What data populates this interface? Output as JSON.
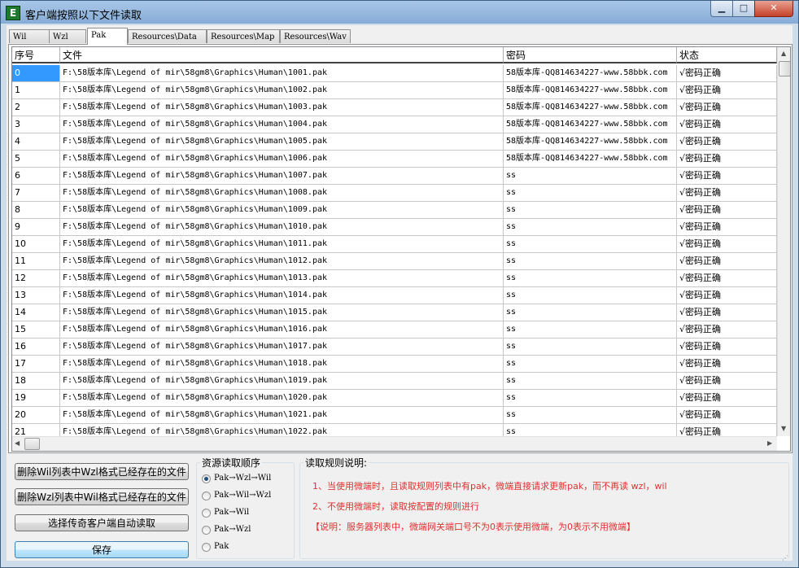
{
  "window": {
    "title": "客户端按照以下文件读取",
    "icon": "E"
  },
  "tabs": [
    {
      "label": "Wil",
      "active": false
    },
    {
      "label": "Wzl",
      "active": false
    },
    {
      "label": "Pak",
      "active": true
    },
    {
      "label": "Resources\\Data",
      "active": false
    },
    {
      "label": "Resources\\Map",
      "active": false
    },
    {
      "label": "Resources\\Wav",
      "active": false
    }
  ],
  "grid": {
    "headers": [
      "序号",
      "文件",
      "密码",
      "状态"
    ],
    "rows": [
      [
        "0",
        "F:\\58版本库\\Legend of mir\\58gm8\\Graphics\\Human\\1001.pak",
        "58版本库-QQ814634227-www.58bbk.com",
        "√密码正确"
      ],
      [
        "1",
        "F:\\58版本库\\Legend of mir\\58gm8\\Graphics\\Human\\1002.pak",
        "58版本库-QQ814634227-www.58bbk.com",
        "√密码正确"
      ],
      [
        "2",
        "F:\\58版本库\\Legend of mir\\58gm8\\Graphics\\Human\\1003.pak",
        "58版本库-QQ814634227-www.58bbk.com",
        "√密码正确"
      ],
      [
        "3",
        "F:\\58版本库\\Legend of mir\\58gm8\\Graphics\\Human\\1004.pak",
        "58版本库-QQ814634227-www.58bbk.com",
        "√密码正确"
      ],
      [
        "4",
        "F:\\58版本库\\Legend of mir\\58gm8\\Graphics\\Human\\1005.pak",
        "58版本库-QQ814634227-www.58bbk.com",
        "√密码正确"
      ],
      [
        "5",
        "F:\\58版本库\\Legend of mir\\58gm8\\Graphics\\Human\\1006.pak",
        "58版本库-QQ814634227-www.58bbk.com",
        "√密码正确"
      ],
      [
        "6",
        "F:\\58版本库\\Legend of mir\\58gm8\\Graphics\\Human\\1007.pak",
        "ss",
        "√密码正确"
      ],
      [
        "7",
        "F:\\58版本库\\Legend of mir\\58gm8\\Graphics\\Human\\1008.pak",
        "ss",
        "√密码正确"
      ],
      [
        "8",
        "F:\\58版本库\\Legend of mir\\58gm8\\Graphics\\Human\\1009.pak",
        "ss",
        "√密码正确"
      ],
      [
        "9",
        "F:\\58版本库\\Legend of mir\\58gm8\\Graphics\\Human\\1010.pak",
        "ss",
        "√密码正确"
      ],
      [
        "10",
        "F:\\58版本库\\Legend of mir\\58gm8\\Graphics\\Human\\1011.pak",
        "ss",
        "√密码正确"
      ],
      [
        "11",
        "F:\\58版本库\\Legend of mir\\58gm8\\Graphics\\Human\\1012.pak",
        "ss",
        "√密码正确"
      ],
      [
        "12",
        "F:\\58版本库\\Legend of mir\\58gm8\\Graphics\\Human\\1013.pak",
        "ss",
        "√密码正确"
      ],
      [
        "13",
        "F:\\58版本库\\Legend of mir\\58gm8\\Graphics\\Human\\1014.pak",
        "ss",
        "√密码正确"
      ],
      [
        "14",
        "F:\\58版本库\\Legend of mir\\58gm8\\Graphics\\Human\\1015.pak",
        "ss",
        "√密码正确"
      ],
      [
        "15",
        "F:\\58版本库\\Legend of mir\\58gm8\\Graphics\\Human\\1016.pak",
        "ss",
        "√密码正确"
      ],
      [
        "16",
        "F:\\58版本库\\Legend of mir\\58gm8\\Graphics\\Human\\1017.pak",
        "ss",
        "√密码正确"
      ],
      [
        "17",
        "F:\\58版本库\\Legend of mir\\58gm8\\Graphics\\Human\\1018.pak",
        "ss",
        "√密码正确"
      ],
      [
        "18",
        "F:\\58版本库\\Legend of mir\\58gm8\\Graphics\\Human\\1019.pak",
        "ss",
        "√密码正确"
      ],
      [
        "19",
        "F:\\58版本库\\Legend of mir\\58gm8\\Graphics\\Human\\1020.pak",
        "ss",
        "√密码正确"
      ],
      [
        "20",
        "F:\\58版本库\\Legend of mir\\58gm8\\Graphics\\Human\\1021.pak",
        "ss",
        "√密码正确"
      ],
      [
        "21",
        "F:\\58版本库\\Legend of mir\\58gm8\\Graphics\\Human\\1022.pak",
        "ss",
        "√密码正确"
      ]
    ]
  },
  "buttons": {
    "delete_wil": "删除Wil列表中Wzl格式已经存在的文件",
    "delete_wzl": "删除Wzl列表中Wil格式已经存在的文件",
    "select_client": "选择传奇客户端自动读取",
    "save": "保存"
  },
  "resource_order": {
    "title": "资源读取顺序",
    "options": [
      {
        "label": "Pak→Wzl→Wil",
        "checked": true
      },
      {
        "label": "Pak→Wil→Wzl",
        "checked": false
      },
      {
        "label": "Pak→Wil",
        "checked": false
      },
      {
        "label": "Pak→Wzl",
        "checked": false
      },
      {
        "label": "Pak",
        "checked": false
      }
    ]
  },
  "rules": {
    "title": "读取规则说明:",
    "lines": [
      "1、当使用微端时，且读取规则列表中有pak，微端直接请求更新pak，而不再读 wzl，wil",
      "2、不使用微端时，读取按配置的规则进行",
      "【说明：服务器列表中，微端网关端口号不为0表示使用微端，为0表示不用微端】"
    ]
  },
  "colors": {
    "selection": "#3399ff",
    "rule_text": "#e03030"
  }
}
